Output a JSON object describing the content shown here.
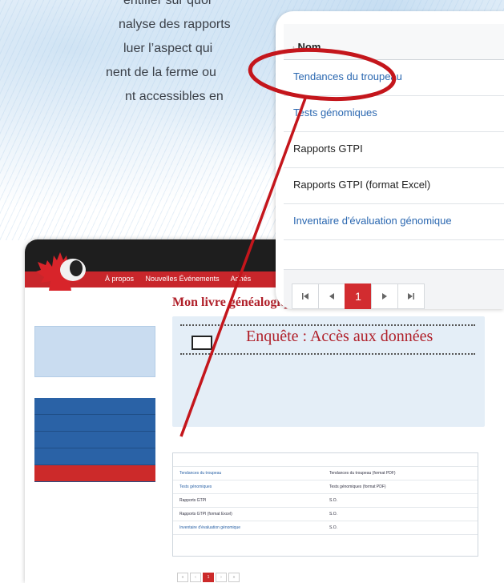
{
  "intro_text": [
    "entifier sur quoi",
    "nalyse des rapports",
    "luer l’aspect qui",
    "nent de la ferme ou",
    "nt accessibles en"
  ],
  "inset": {
    "header_label": "Nom",
    "sort_icon": "sort-icon",
    "rows": [
      {
        "label": "Tendances du troupeau",
        "link": true
      },
      {
        "label": "Tests génomiques",
        "link": true
      },
      {
        "label": "Rapports GTPI",
        "link": false
      },
      {
        "label": "Rapports GTPI (format Excel)",
        "link": false
      },
      {
        "label": "Inventaire d'évaluation génomique",
        "link": true
      }
    ],
    "pager": {
      "first": "⏮",
      "prev": "◀",
      "current": "1",
      "next": "▶",
      "last": "⏭"
    }
  },
  "app": {
    "nav": [
      "À propos",
      "Nouvelles Événements",
      "Adhés"
    ],
    "page_title": "Mon livre généalogique",
    "survey_title": "Enquête : Accès aux données",
    "table_rows": [
      {
        "name": "Tendances du troupeau",
        "desc": "Tendances du troupeau (format PDF)"
      },
      {
        "name": "Tests génomiques",
        "desc": "Tests génomiques (format PDF)"
      },
      {
        "name": "Rapports GTPI",
        "desc": "S.O."
      },
      {
        "name": "Rapports GTPI (format Excel)",
        "desc": "S.O."
      },
      {
        "name": "Inventaire d'évaluation génomique",
        "desc": "S.O."
      }
    ],
    "pager_current": "1"
  },
  "colors": {
    "brand_red": "#c8262b",
    "link_blue": "#2a67b0",
    "annotation_red": "#c4161c"
  }
}
